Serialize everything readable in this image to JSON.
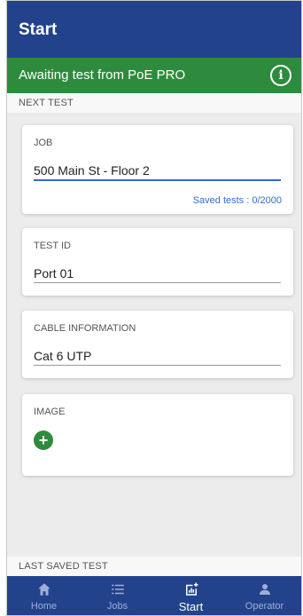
{
  "app_bar": {
    "title": "Start"
  },
  "status": {
    "message": "Awaiting test from PoE PRO",
    "info_icon": "info-icon"
  },
  "sections": {
    "next_test": "NEXT TEST",
    "last_saved_test": "LAST SAVED TEST"
  },
  "job": {
    "label": "JOB",
    "value": "500 Main St - Floor 2",
    "saved_tests": "Saved tests : 0/2000"
  },
  "test_id": {
    "label": "TEST ID",
    "value": "Port 01"
  },
  "cable": {
    "label": "CABLE INFORMATION",
    "value": "Cat 6 UTP"
  },
  "image": {
    "label": "IMAGE",
    "add_icon": "plus-circle-icon"
  },
  "nav": {
    "items": [
      {
        "label": "Home",
        "icon": "home-icon"
      },
      {
        "label": "Jobs",
        "icon": "list-icon"
      },
      {
        "label": "Start",
        "icon": "chart-add-icon"
      },
      {
        "label": "Operator",
        "icon": "person-icon"
      }
    ],
    "active": "Start"
  },
  "colors": {
    "primary": "#22428c",
    "success": "#2e8b3e",
    "accent": "#2e6fd0"
  }
}
